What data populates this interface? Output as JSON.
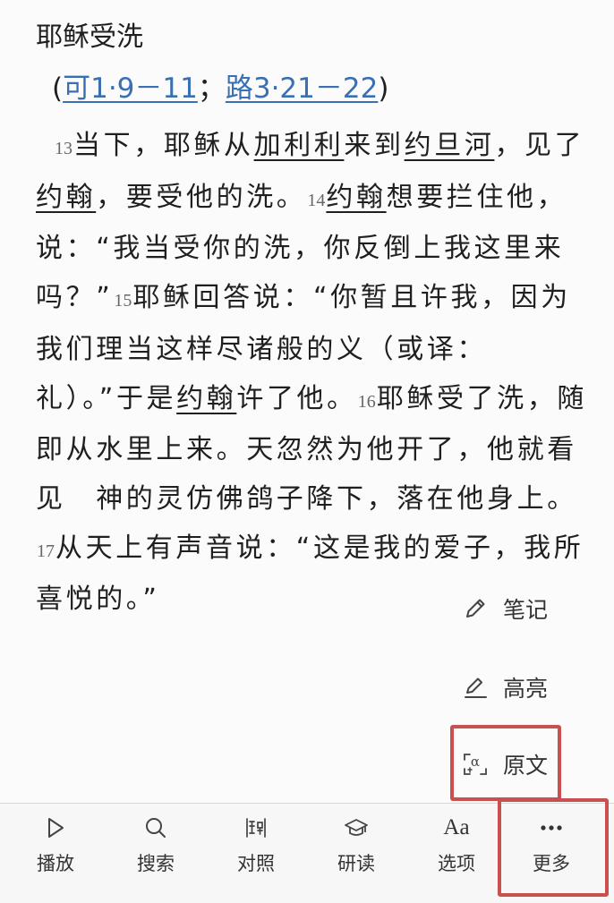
{
  "passage": {
    "heading": "耶稣受洗",
    "ref_open": "(",
    "ref1": "可1·9－11",
    "ref_sep": "；",
    "ref2": "路3·21－22",
    "ref_close": ")"
  },
  "verses": {
    "v13_num": "13",
    "v13_a": "当下，耶稣从",
    "v13_place1": "加利利",
    "v13_b": "来到",
    "v13_place2": "约旦河",
    "v13_c": "，见了",
    "v13_name": "约翰",
    "v13_d": "，要受他的洗。",
    "v14_num": "14",
    "v14_name": "约翰",
    "v14_a": "想要拦住他，说：“我当受你的洗，你反倒上我这里来吗？”",
    "v15_num": "15",
    "v15_a": "耶稣回答说：“你暂且许我，因为我们理当这样尽诸般的义（或译：礼）。”于是",
    "v15_name": "约翰",
    "v15_b": "许了他。",
    "v16_num": "16",
    "v16_a": "耶稣受了洗，随即从水里上来。天忽然为他开了，他就看见　神的灵仿佛鸽子降下，落在他身上。",
    "v17_num": "17",
    "v17_a": "从天上有声音说：“这是我的爱子，我所喜悦的。”"
  },
  "actions": {
    "note": "笔记",
    "highlight": "高亮",
    "original": "原文"
  },
  "tabbar": {
    "play": "播放",
    "search": "搜索",
    "compare": "对照",
    "study": "研读",
    "options": "选项",
    "options_glyph": "Aa",
    "more": "更多"
  },
  "colors": {
    "link": "#3a6fb3",
    "annotation_box": "#c9504f"
  }
}
